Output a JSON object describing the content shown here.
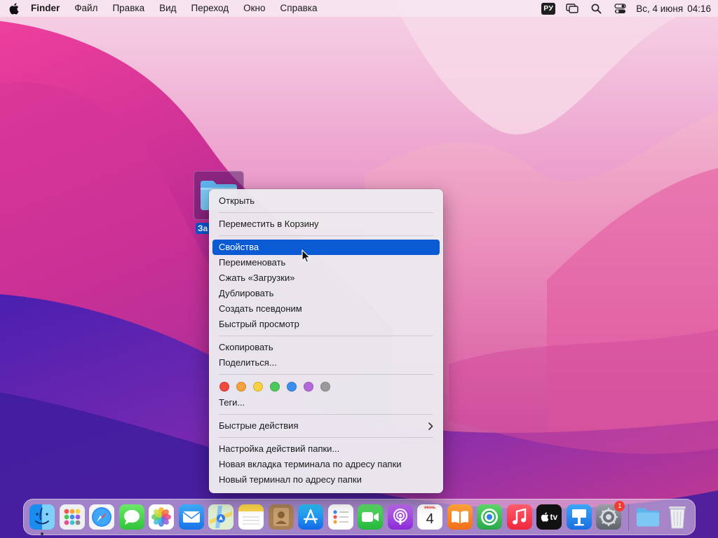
{
  "menubar": {
    "app_name": "Finder",
    "items": [
      "Файл",
      "Правка",
      "Вид",
      "Переход",
      "Окно",
      "Справка"
    ],
    "input_source": "РУ",
    "date": "Вс, 4 июня",
    "time": "04:16",
    "icons": [
      "apple-icon",
      "screen-mirroring-icon",
      "spotlight-search-icon",
      "control-center-icon"
    ]
  },
  "desktop": {
    "selected_item_label": "За"
  },
  "context_menu": {
    "items": [
      {
        "label": "Открыть"
      },
      {
        "label": "Переместить в Корзину"
      },
      {
        "label": "Свойства",
        "highlighted": true
      },
      {
        "label": "Переименовать"
      },
      {
        "label": "Сжать «Загрузки»"
      },
      {
        "label": "Дублировать"
      },
      {
        "label": "Создать псевдоним"
      },
      {
        "label": "Быстрый просмотр"
      },
      {
        "label": "Скопировать"
      },
      {
        "label": "Поделиться..."
      },
      {
        "label": "Теги..."
      },
      {
        "label": "Быстрые действия",
        "submenu": true
      },
      {
        "label": "Настройка действий папки..."
      },
      {
        "label": "Новая вкладка терминала по адресу папки"
      },
      {
        "label": "Новый терминал по адресу папки"
      }
    ],
    "tag_colors": [
      "#f0483e",
      "#f5a23a",
      "#f8d13f",
      "#4dc85a",
      "#3d8cf0",
      "#b36ad8",
      "#9a9a9a"
    ],
    "highlight_color": "#0a5bd3"
  },
  "dock": {
    "apps": [
      "finder-icon",
      "launchpad-icon",
      "safari-icon",
      "messages-icon",
      "photos-icon",
      "mail-icon",
      "maps-icon",
      "notes-icon",
      "contacts-icon",
      "app-store-icon",
      "reminders-icon",
      "facetime-icon",
      "podcasts-icon",
      "calendar-icon",
      "books-icon",
      "find-my-icon",
      "music-icon",
      "apple-tv-icon",
      "keynote-icon",
      "system-settings-icon",
      "downloads-folder-icon",
      "trash-icon"
    ],
    "calendar_month": "июнь",
    "calendar_day": "4",
    "tv_label": "tv",
    "settings_badge": "1"
  }
}
